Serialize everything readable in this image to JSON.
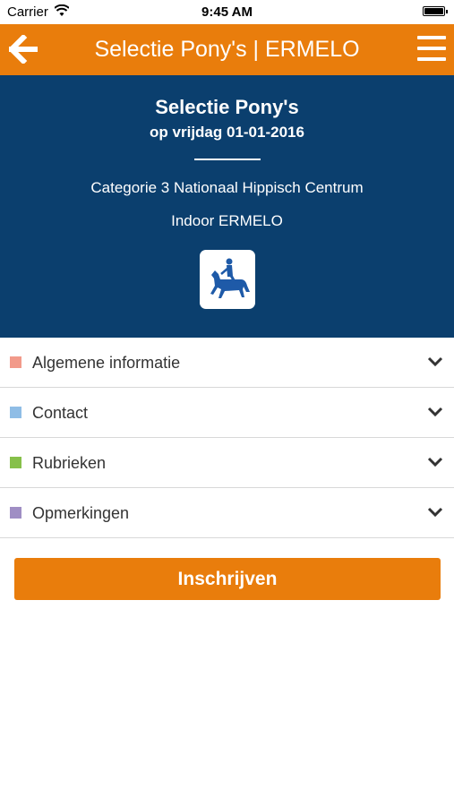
{
  "status": {
    "carrier": "Carrier",
    "time": "9:45 AM"
  },
  "nav": {
    "title": "Selectie Pony's | ERMELO",
    "back_icon": "arrow-left-icon",
    "menu_icon": "hamburger-menu-icon"
  },
  "event": {
    "title": "Selectie Pony's",
    "date": "op vrijdag 01-01-2016",
    "category": "Categorie 3 Nationaal Hippisch Centrum",
    "location": "Indoor ERMELO",
    "discipline_icon": "dressage-rider-icon"
  },
  "sections": [
    {
      "label": "Algemene informatie",
      "color": "#f29a8a"
    },
    {
      "label": "Contact",
      "color": "#8fbde6"
    },
    {
      "label": "Rubrieken",
      "color": "#86c04a"
    },
    {
      "label": "Opmerkingen",
      "color": "#9f8ec4"
    }
  ],
  "cta": {
    "label": "Inschrijven"
  },
  "colors": {
    "brand_orange": "#e97d0c",
    "header_blue": "#0b3f6e",
    "icon_blue": "#1e5aa8"
  }
}
